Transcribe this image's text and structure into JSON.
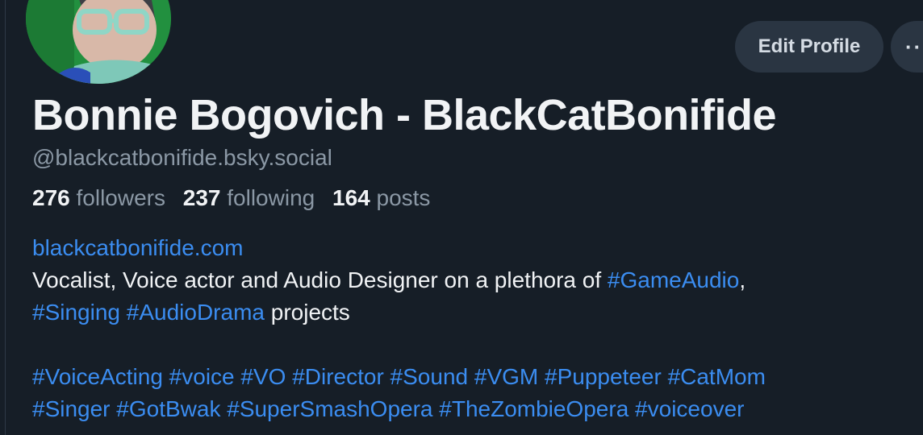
{
  "profile": {
    "display_name": "Bonnie Bogovich - BlackCatBonifide",
    "handle": "@blackcatbonifide.bsky.social",
    "edit_button": "Edit Profile",
    "more_button": "··",
    "avatar_icon": "user-avatar"
  },
  "stats": {
    "followers_count": "276",
    "followers_label": "followers",
    "following_count": "237",
    "following_label": "following",
    "posts_count": "164",
    "posts_label": "posts"
  },
  "bio": {
    "website": "blackcatbonifide.com",
    "line1_text": "Vocalist, Voice actor and Audio Designer on a plethora of ",
    "line1_tag": "#GameAudio",
    "line1_end": ",",
    "line2_tag1": "#Singing",
    "line2_tag2": "#AudioDrama",
    "line2_text": " projects",
    "line3_tags": "#VoiceActing #voice #VO #Director #Sound #VGM #Puppeteer #CatMom",
    "line4_tags": "#Singer #GotBwak #SuperSmashOpera #TheZombieOpera #voiceover"
  },
  "colors": {
    "background": "#161e27",
    "link": "#3b8df1",
    "muted": "#8b98a5",
    "button_bg": "#2a3542"
  }
}
